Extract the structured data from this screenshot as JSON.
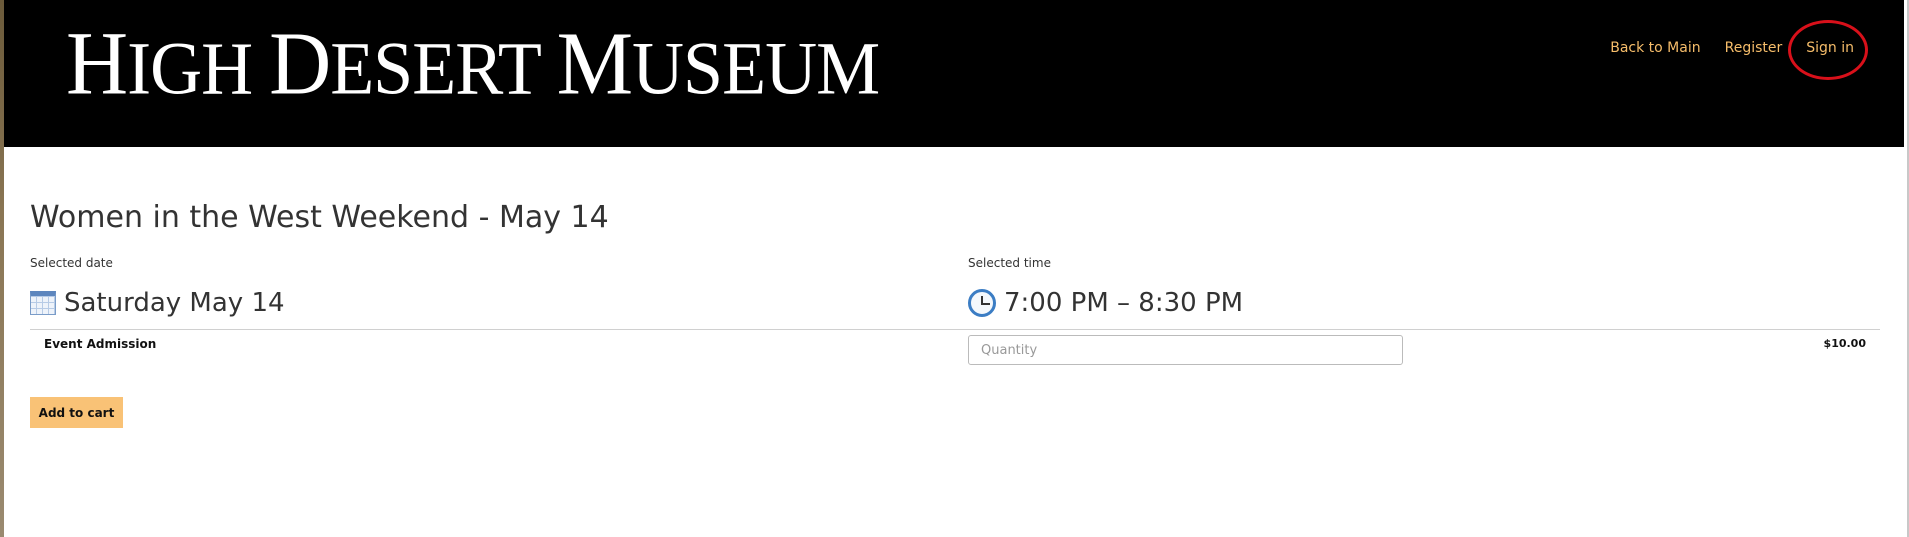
{
  "header": {
    "logo": {
      "high_h": "H",
      "high_rest": "IGH",
      "desert_d": "D",
      "desert_rest": "ESERT",
      "museum_m": "M",
      "museum_rest": "USEUM"
    },
    "nav": {
      "back_to_main": "Back to Main",
      "register": "Register",
      "sign_in": "Sign in"
    },
    "annotation_color": "#d8101a",
    "link_color": "#f6bd6a"
  },
  "event": {
    "title": "Women in the West Weekend - May 14",
    "date_label": "Selected date",
    "date_value": "Saturday May 14",
    "date_icon": "calendar-icon",
    "time_label": "Selected time",
    "time_value": "7:00 PM  –  8:30 PM",
    "time_icon": "clock-icon"
  },
  "ticket": {
    "name": "Event Admission",
    "quantity_placeholder": "Quantity",
    "quantity_value": "",
    "price": "$10.00"
  },
  "actions": {
    "add_to_cart": "Add to cart",
    "button_color": "#f9c276"
  }
}
